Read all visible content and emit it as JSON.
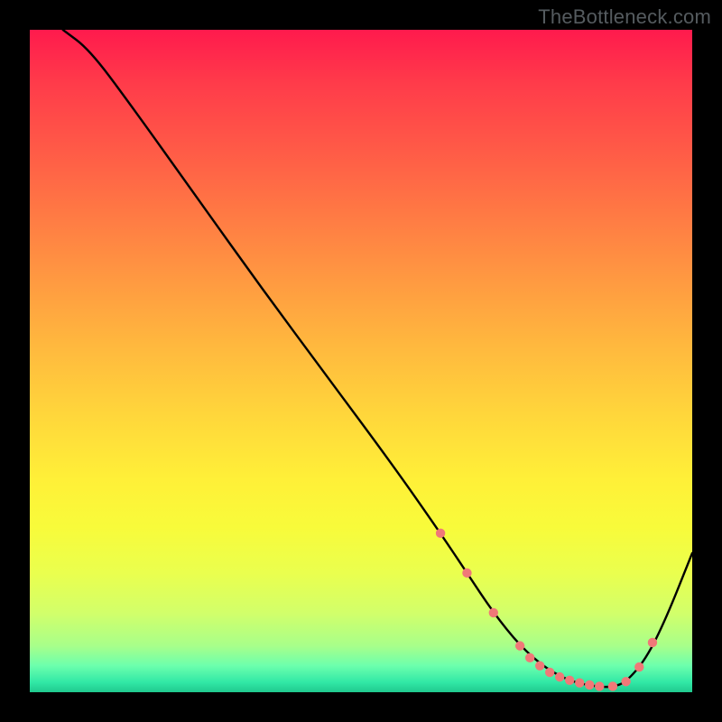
{
  "watermark": "TheBottleneck.com",
  "chart_data": {
    "type": "line",
    "title": "",
    "xlabel": "",
    "ylabel": "",
    "xlim": [
      0,
      100
    ],
    "ylim": [
      0,
      100
    ],
    "grid": false,
    "legend": false,
    "series": [
      {
        "name": "curve",
        "color": "#000000",
        "x": [
          5,
          9,
          15,
          25,
          35,
          45,
          55,
          62,
          66,
          70,
          74,
          78,
          82,
          86,
          88,
          90,
          93,
          96,
          100
        ],
        "y": [
          100,
          97,
          89,
          75,
          61,
          47.5,
          34,
          24,
          18,
          12,
          7,
          3.5,
          1.5,
          0.8,
          0.8,
          1.5,
          5,
          11,
          21
        ]
      },
      {
        "name": "markers",
        "color": "#f07878",
        "type": "scatter",
        "x": [
          62,
          66,
          70,
          74,
          75.5,
          77,
          78.5,
          80,
          81.5,
          83,
          84.5,
          86,
          88,
          90,
          92,
          94
        ],
        "y": [
          24,
          18,
          12,
          7,
          5.2,
          4,
          3,
          2.3,
          1.8,
          1.4,
          1.1,
          0.9,
          0.9,
          1.6,
          3.8,
          7.5
        ]
      }
    ]
  }
}
